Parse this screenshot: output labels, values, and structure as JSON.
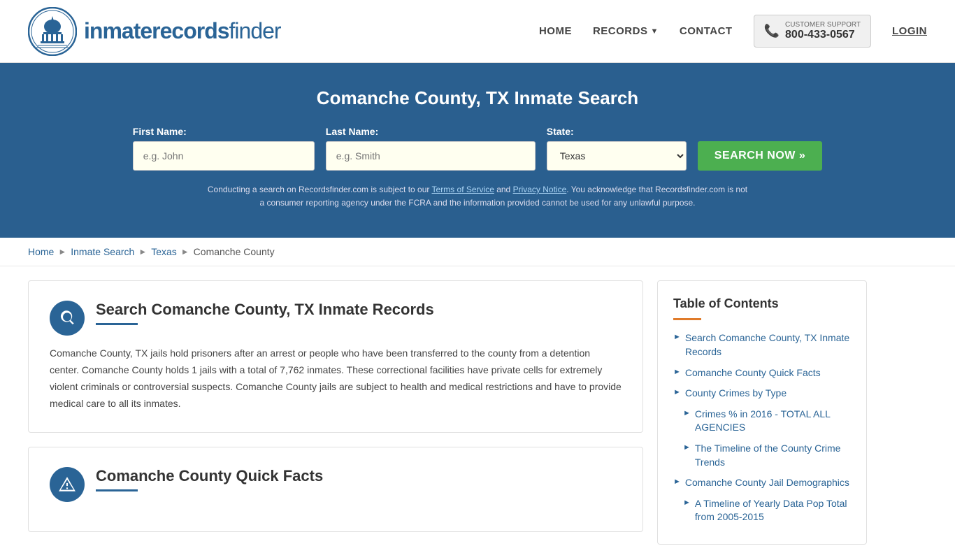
{
  "header": {
    "logo_text_light": "inmaterecords",
    "logo_text_bold": "finder",
    "nav": {
      "home": "HOME",
      "records": "RECORDS",
      "contact": "CONTACT",
      "login": "LOGIN"
    },
    "customer_support": {
      "label": "CUSTOMER SUPPORT",
      "phone": "800-433-0567"
    }
  },
  "hero": {
    "title": "Comanche County, TX Inmate Search",
    "form": {
      "first_name_label": "First Name:",
      "first_name_placeholder": "e.g. John",
      "last_name_label": "Last Name:",
      "last_name_placeholder": "e.g. Smith",
      "state_label": "State:",
      "state_value": "Texas",
      "search_button": "SEARCH NOW »"
    },
    "disclaimer": "Conducting a search on Recordsfinder.com is subject to our Terms of Service and Privacy Notice. You acknowledge that Recordsfinder.com is not a consumer reporting agency under the FCRA and the information provided cannot be used for any unlawful purpose."
  },
  "breadcrumb": {
    "items": [
      "Home",
      "Inmate Search",
      "Texas",
      "Comanche County"
    ]
  },
  "main": {
    "section1": {
      "title": "Search Comanche County, TX Inmate Records",
      "body": "Comanche County, TX jails hold prisoners after an arrest or people who have been transferred to the county from a detention center. Comanche County holds 1 jails with a total of 7,762 inmates. These correctional facilities have private cells for extremely violent criminals or controversial suspects. Comanche County jails are subject to health and medical restrictions and have to provide medical care to all its inmates."
    },
    "section2": {
      "title": "Comanche County Quick Facts"
    }
  },
  "sidebar": {
    "toc_title": "Table of Contents",
    "items": [
      {
        "label": "Search Comanche County, TX Inmate Records",
        "sub": false
      },
      {
        "label": "Comanche County Quick Facts",
        "sub": false
      },
      {
        "label": "County Crimes by Type",
        "sub": false
      },
      {
        "label": "Crimes % in 2016 - TOTAL ALL AGENCIES",
        "sub": true
      },
      {
        "label": "The Timeline of the County Crime Trends",
        "sub": true
      },
      {
        "label": "Comanche County Jail Demographics",
        "sub": false
      },
      {
        "label": "A Timeline of Yearly Data Pop Total from 2005-2015",
        "sub": true
      }
    ]
  }
}
